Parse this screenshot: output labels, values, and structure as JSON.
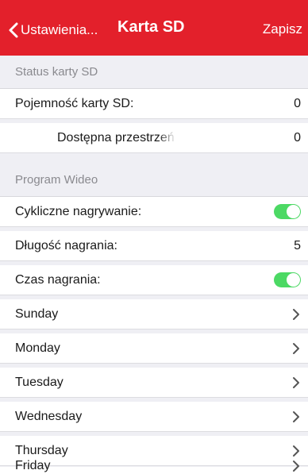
{
  "nav": {
    "back_label": "Ustawienia...",
    "title": "Karta SD",
    "save_label": "Zapisz"
  },
  "sections": {
    "sd_status": "Status karty SD",
    "video_program": "Program Wideo"
  },
  "sd": {
    "capacity_label": "Pojemność karty SD:",
    "capacity_value": "0",
    "available_label": "Dostępna przestrzeń",
    "available_value": "0"
  },
  "video": {
    "cyclic_label": "Cykliczne nagrywanie:",
    "cyclic_on": true,
    "duration_label": "Długość nagrania:",
    "duration_value": "5",
    "time_label": "Czas nagrania:",
    "time_on": true
  },
  "days": [
    "Sunday",
    "Monday",
    "Tuesday",
    "Wednesday",
    "Thursday",
    "Friday"
  ],
  "colors": {
    "accent": "#e3202b",
    "toggle_on": "#4cd964"
  },
  "icons": {
    "back": "chevron-left-icon",
    "disclosure": "chevron-right-icon"
  }
}
